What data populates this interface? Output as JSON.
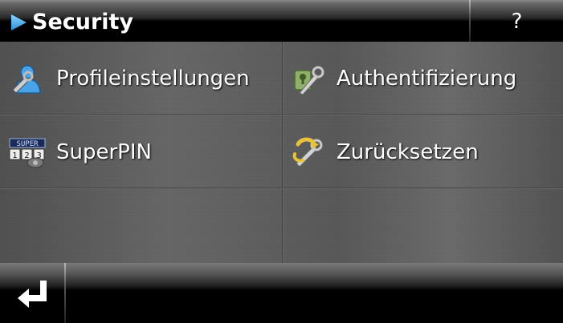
{
  "header": {
    "title": "Security",
    "help_label": "?"
  },
  "menu": {
    "items": [
      {
        "label": "Profileinstellungen",
        "icon": "profile-settings-icon"
      },
      {
        "label": "Authentifizierung",
        "icon": "authentication-icon"
      },
      {
        "label": "SuperPIN",
        "icon": "superpin-icon",
        "icon_text": "SUPER 123"
      },
      {
        "label": "Zurücksetzen",
        "icon": "reset-icon"
      }
    ]
  },
  "footer": {
    "back_icon": "return-arrow-icon"
  },
  "colors": {
    "accent_blue": "#3aa6e8",
    "text": "#ffffff",
    "bar": "#000000",
    "panel": "#5b5b5b"
  }
}
